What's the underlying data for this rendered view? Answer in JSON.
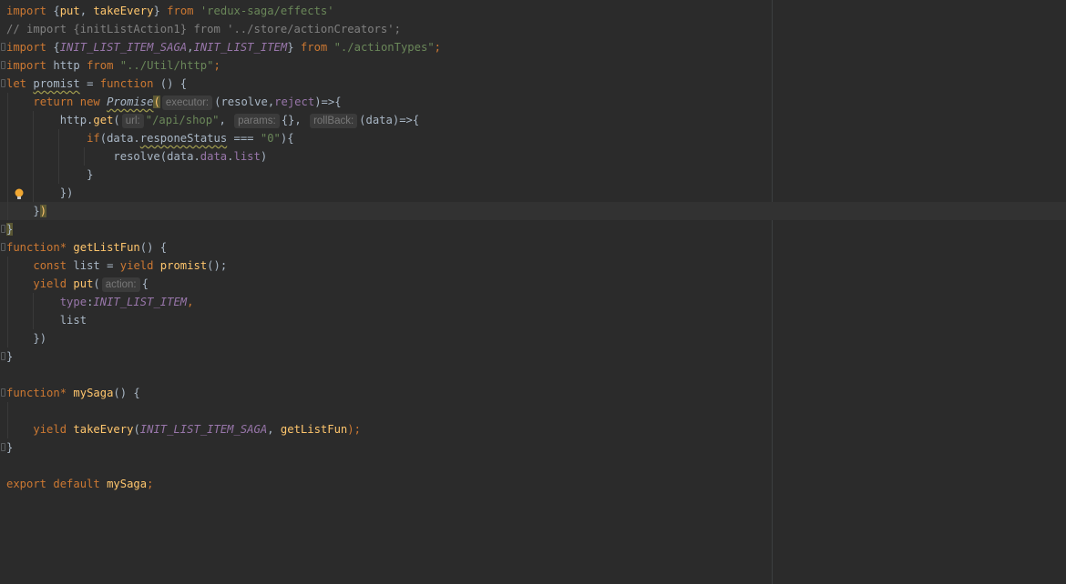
{
  "editor": {
    "theme_colors": {
      "background": "#2b2b2b",
      "keyword": "#cc7832",
      "string": "#6a8759",
      "comment": "#808080",
      "function": "#ffc66d",
      "constant": "#9876aa",
      "default_text": "#a9b7c6"
    }
  },
  "code": {
    "l1": {
      "t1": "import ",
      "t2": "{",
      "t3": "put",
      "t4": ", ",
      "t5": "takeEvery",
      "t6": "} ",
      "t7": "from ",
      "t8": "'redux-saga/effects'"
    },
    "l2": {
      "t1": "// import {initListAction1} from '../store/actionCreators';"
    },
    "l3": {
      "t1": "import ",
      "t2": "{",
      "t3": "INIT_LIST_ITEM_SAGA",
      "t4": ",",
      "t5": "INIT_LIST_ITEM",
      "t6": "} ",
      "t7": "from ",
      "t8": "\"./actionTypes\"",
      "t9": ";"
    },
    "l4": {
      "t1": "import ",
      "t2": "http ",
      "t3": "from ",
      "t4": "\"../Util/http\"",
      "t5": ";"
    },
    "l5": {
      "t1": "let ",
      "t2": "promist",
      "t3": " = ",
      "t4": "function ",
      "t5": "() {"
    },
    "l6": {
      "t1": "return ",
      "t2": "new ",
      "t3": "Promise",
      "t4": "(",
      "hint": "executor:",
      "t5": "(resolve,",
      "t6": "reject",
      "t7": ")=>{"
    },
    "l7": {
      "t1": "http.",
      "t2": "get",
      "t3": "(",
      "hint1": "url:",
      "t4": "\"/api/shop\"",
      "t5": ", ",
      "hint2": "params:",
      "t6": "{}",
      "t7": ", ",
      "hint3": "rollBack:",
      "t8": "(data)=>{"
    },
    "l8": {
      "t1": "if",
      "t2": "(data.",
      "t3": "responeStatus",
      "t4": " === ",
      "t5": "\"0\"",
      "t6": "){"
    },
    "l9": {
      "t1": "resolve(data.",
      "t2": "data",
      "t3": ".",
      "t4": "list",
      "t5": ")"
    },
    "l10": {
      "t1": "}"
    },
    "l11": {
      "t1": "})"
    },
    "l12": {
      "t1": "}",
      "t2": ")"
    },
    "l13": {
      "t1": "}"
    },
    "l14": {
      "t1": "function",
      "t2": "* ",
      "t3": "getListFun",
      "t4": "() {"
    },
    "l15": {
      "t1": "const ",
      "t2": "list = ",
      "t3": "yield ",
      "t4": "promist",
      "t5": "();"
    },
    "l16": {
      "t1": "yield ",
      "t2": "put",
      "t3": "(",
      "hint": "action:",
      "t4": "{"
    },
    "l17": {
      "t1": "type",
      "t2": ":",
      "t3": "INIT_LIST_ITEM",
      "t4": ","
    },
    "l18": {
      "t1": "list"
    },
    "l19": {
      "t1": "})"
    },
    "l20": {
      "t1": "}"
    },
    "l22": {
      "t1": "function",
      "t2": "* ",
      "t3": "mySaga",
      "t4": "() {"
    },
    "l24": {
      "t1": "yield ",
      "t2": "takeEvery",
      "t3": "(",
      "t4": "INIT_LIST_ITEM_SAGA",
      "t5": ", ",
      "t6": "getListFun",
      "t7": ");"
    },
    "l25": {
      "t1": "}"
    },
    "l27": {
      "t1": "export ",
      "t2": "default ",
      "t3": "mySaga",
      "t4": ";"
    }
  }
}
